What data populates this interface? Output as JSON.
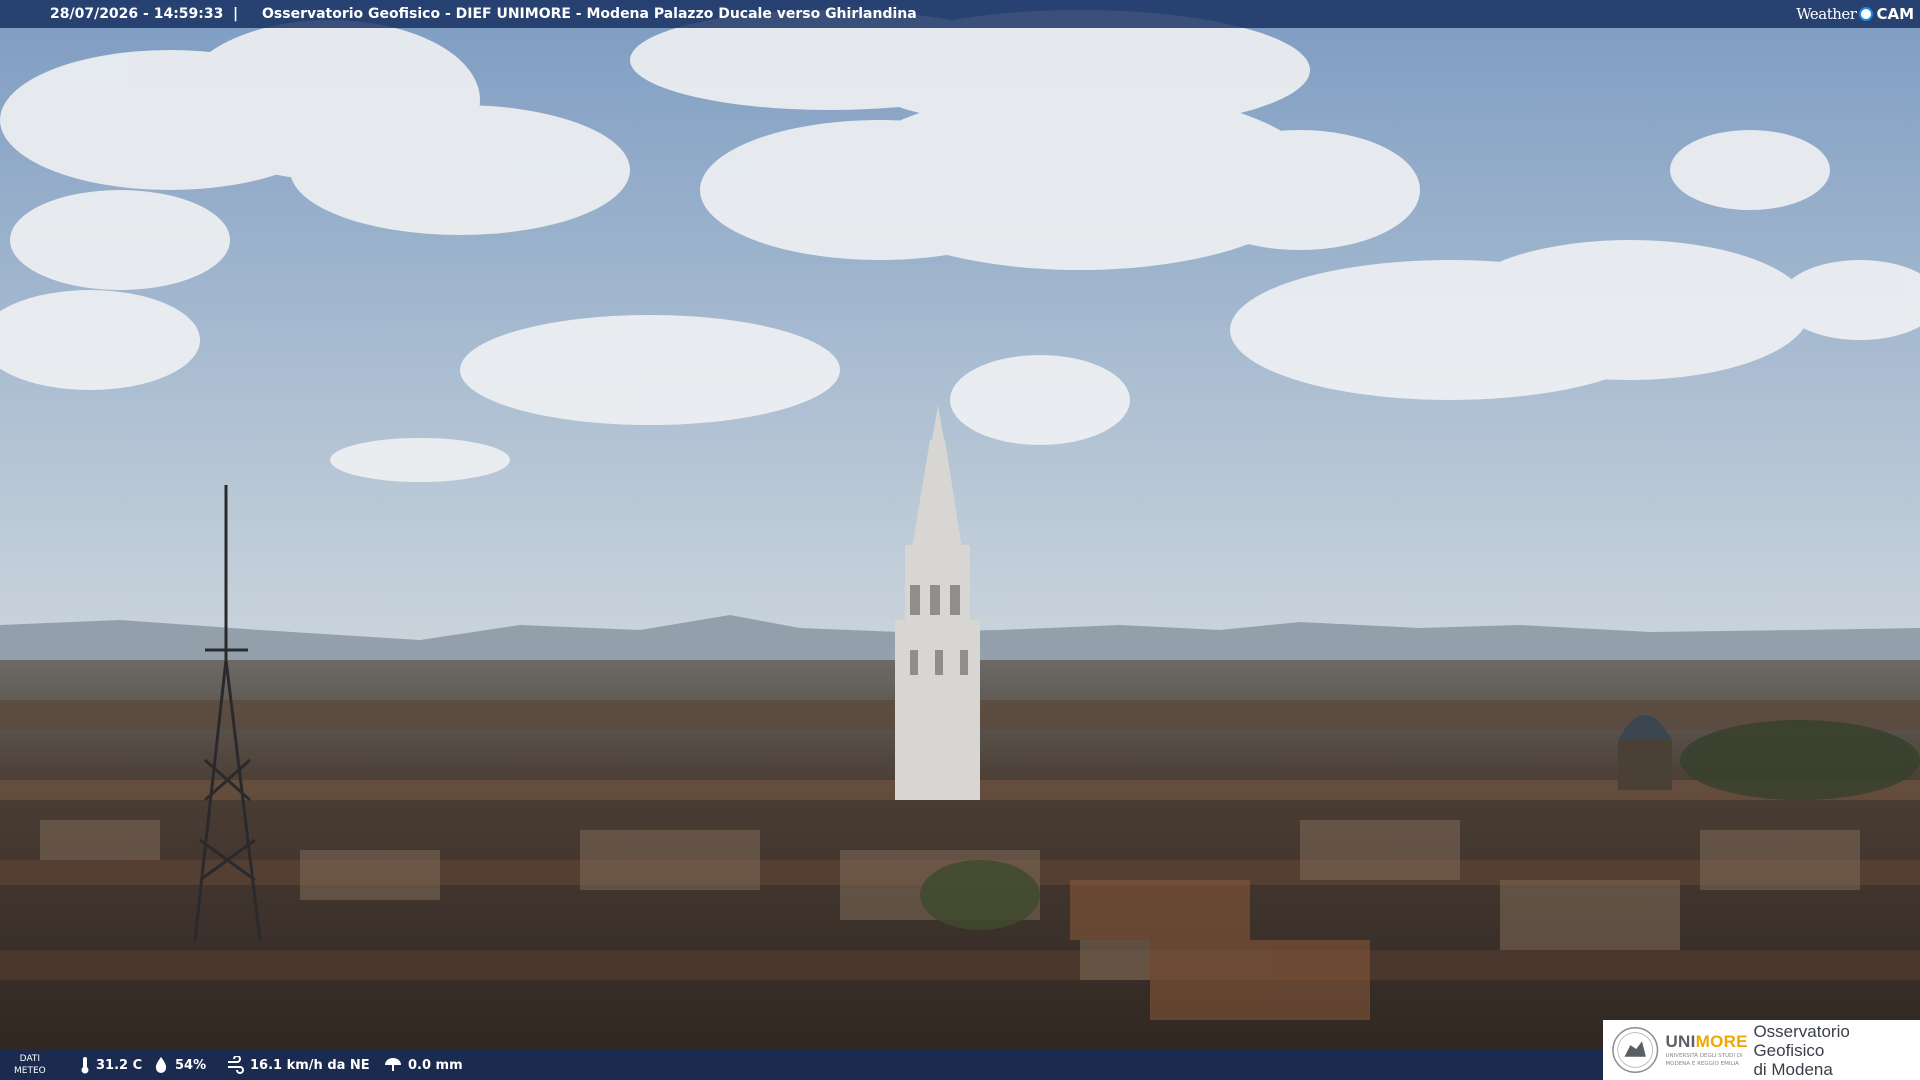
{
  "header": {
    "timestamp": "28/07/2026 - 14:59:33",
    "separator": "|",
    "caption": "Osservatorio Geofisico - DIEF UNIMORE - Modena Palazzo Ducale verso Ghirlandina"
  },
  "logo": {
    "word": "Weather",
    "cam": "CAM"
  },
  "weather_bar": {
    "label_line1": "DATI",
    "label_line2": "METEO",
    "temperature": "31.2 C",
    "humidity": "54%",
    "wind": "16.1 km/h da NE",
    "rain": "0.0 mm"
  },
  "institution": {
    "name_uni": "UNI",
    "name_more": "MORE",
    "subline1": "UNIVERSITÀ DEGLI STUDI DI",
    "subline2": "MODENA E REGGIO EMILIA",
    "observatory_line1": "Osservatorio Geofisico",
    "observatory_line2": "di Modena"
  },
  "colors": {
    "bar": "#142d5f",
    "accent_yellow": "#f0a800",
    "sky_top": "#7d9cc2",
    "sky_bottom": "#c9d4de"
  }
}
